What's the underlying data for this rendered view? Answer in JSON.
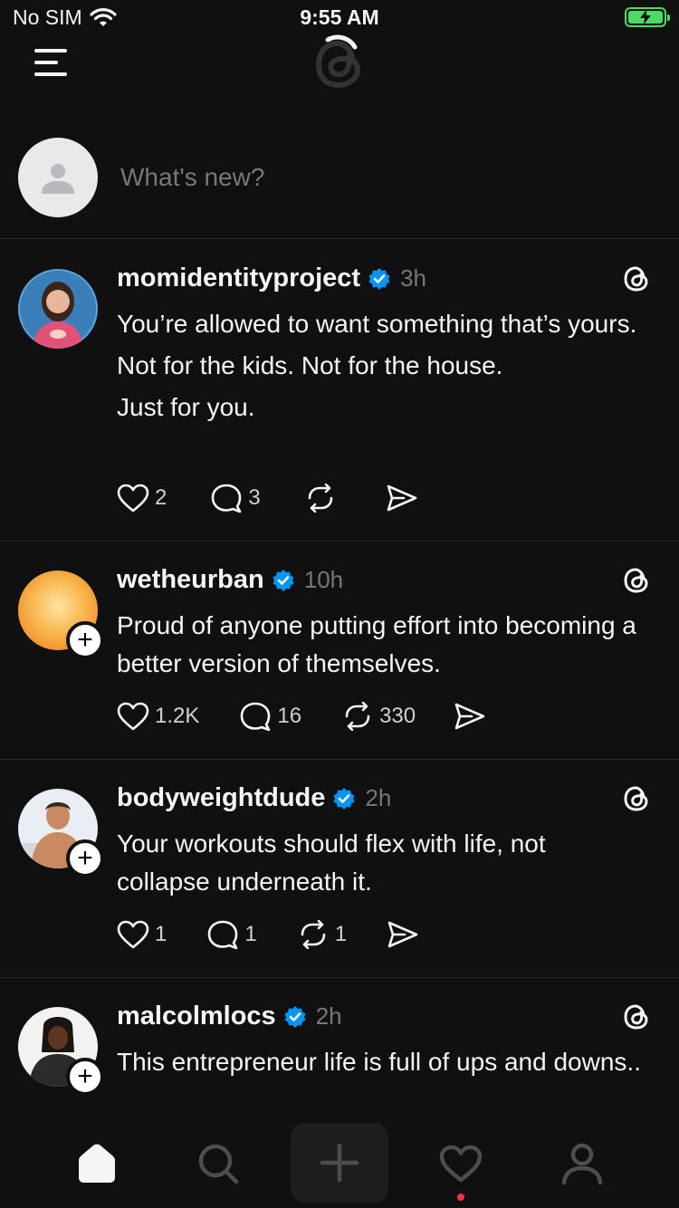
{
  "status_bar": {
    "carrier": "No SIM",
    "time": "9:55 AM",
    "battery_color": "#4cd964"
  },
  "composer": {
    "placeholder": "What's new?"
  },
  "posts": [
    {
      "username": "momidentityproject",
      "verified": true,
      "time": "3h",
      "lines": [
        "You’re allowed to want something that’s yours.",
        "Not for the kids. Not for the house.",
        "Just for you."
      ],
      "likes": "2",
      "replies": "3",
      "reposts": "",
      "show_follow": false
    },
    {
      "username": "wetheurban",
      "verified": true,
      "time": "10h",
      "lines": [
        "Proud of anyone putting effort into becoming a better version of themselves."
      ],
      "likes": "1.2K",
      "replies": "16",
      "reposts": "330",
      "show_follow": true
    },
    {
      "username": "bodyweightdude",
      "verified": true,
      "time": "2h",
      "lines": [
        "Your workouts should flex with life, not collapse underneath it."
      ],
      "likes": "1",
      "replies": "1",
      "reposts": "1",
      "show_follow": true
    },
    {
      "username": "malcolmlocs",
      "verified": true,
      "time": "2h",
      "lines": [
        "This entrepreneur life is full of ups and downs.."
      ],
      "likes": "",
      "replies": "",
      "reposts": "",
      "show_follow": true
    }
  ],
  "tab_bar": {
    "items": [
      "home-icon",
      "search-icon",
      "create-icon",
      "activity-icon",
      "profile-icon"
    ],
    "notification_color": "#ff3040"
  },
  "colors": {
    "background": "#101010",
    "verified": "#0095f6",
    "muted": "#777777"
  }
}
